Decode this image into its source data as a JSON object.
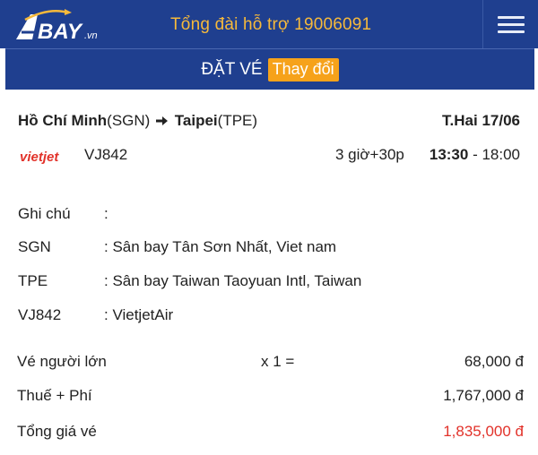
{
  "header": {
    "logo_text": "ABAY.vn",
    "hotline": "Tổng đài hỗ trợ 19006091",
    "menu_icon": "hamburger-menu-icon",
    "bg_color": "#1f3f8f",
    "accent_color": "#f6b93b"
  },
  "booking_bar": {
    "title": "ĐẶT VÉ",
    "change_label": "Thay đổi",
    "change_color": "#f6a21a"
  },
  "flight": {
    "origin_city": "Hồ Chí Minh",
    "origin_code": "(SGN)",
    "destination_city": "Taipei",
    "destination_code": "(TPE)",
    "date": "T.Hai 17/06",
    "airline_logo_text": "vietjet",
    "flight_code": "VJ842",
    "duration": "3 giờ+30p",
    "depart_time": "13:30",
    "time_separator": " - ",
    "arrive_time": "18:00"
  },
  "details": [
    {
      "key": "Ghi chú",
      "value": ":"
    },
    {
      "key": "SGN",
      "value": ": Sân bay Tân Sơn Nhất, Viet nam"
    },
    {
      "key": "TPE",
      "value": ": Sân bay Taiwan Taoyuan Intl, Taiwan"
    },
    {
      "key": "VJ842",
      "value": ": VietjetAir"
    }
  ],
  "prices": {
    "adult_label": "Vé người lớn",
    "adult_multiplier": "x 1 =",
    "adult_value": "68,000 đ",
    "tax_label": "Thuế + Phí",
    "tax_value": "1,767,000 đ",
    "total_label": "Tổng giá vé",
    "total_value": "1,835,000 đ",
    "total_color": "#e2322a"
  }
}
